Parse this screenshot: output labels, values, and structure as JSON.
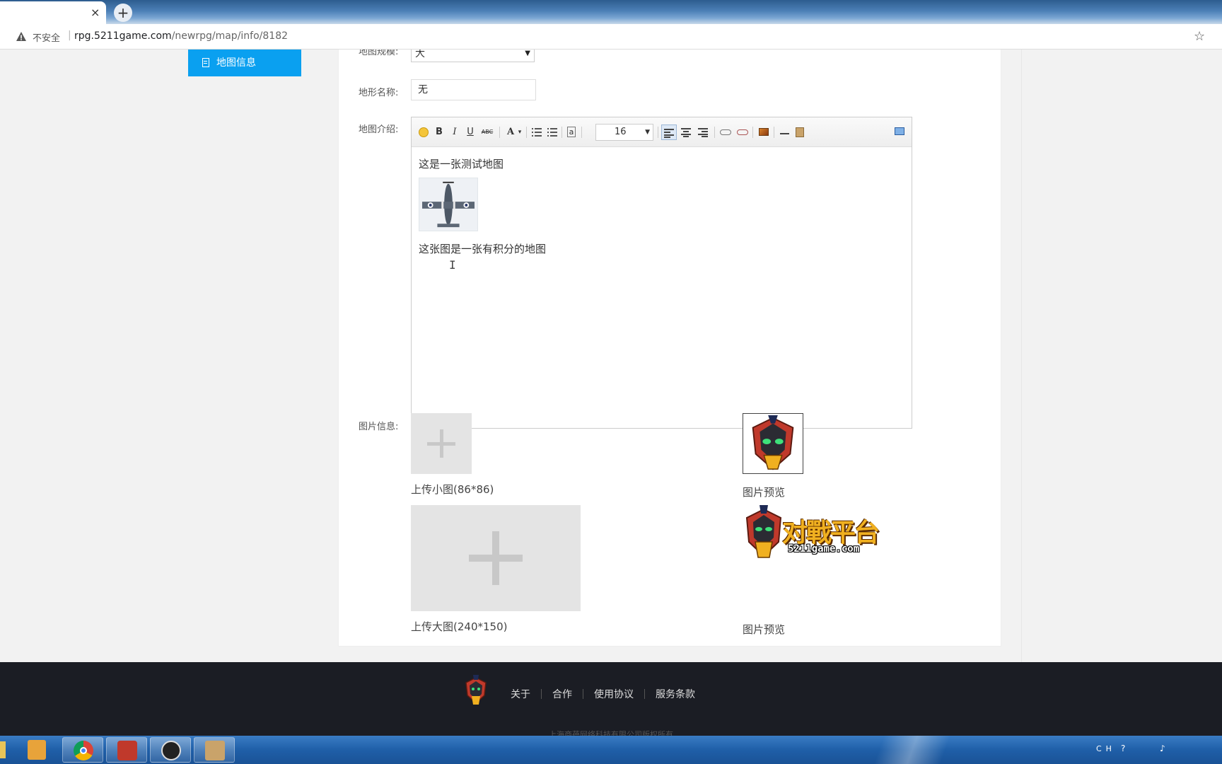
{
  "browser": {
    "tab_close": "×",
    "new_tab": "+",
    "security_label": "不安全",
    "url_host": "rpg.5211game.com",
    "url_path": "/newrpg/map/info/8182"
  },
  "sidebar": {
    "active_item": "地图信息"
  },
  "form": {
    "size_label": "地图规模:",
    "size_value": "大",
    "terrain_label": "地形名称:",
    "terrain_value": "无",
    "intro_label": "地图介绍:",
    "image_label": "图片信息:"
  },
  "editor": {
    "toolbar": {
      "bold": "B",
      "italic": "I",
      "underline": "U",
      "strike": "ABC",
      "font_color": "A",
      "caret": "▾",
      "text_box": "a",
      "font_size": "16"
    },
    "content": {
      "line1": "这是一张测试地图",
      "line2": "这张图是一张有积分的地图"
    }
  },
  "images": {
    "small_upload_caption": "上传小图(86*86)",
    "big_upload_caption": "上传大图(240*150)",
    "preview_caption": "图片预览",
    "logo_text": "对戰平台",
    "logo_domain": "5211game.com"
  },
  "footer": {
    "links": [
      "关于",
      "合作",
      "使用协议",
      "服务条款"
    ],
    "copyright": "上海商蓓网络科技有限公司版权所有"
  },
  "taskbar": {
    "tray_text": "CH"
  },
  "colors": {
    "accent": "#0aa0f0",
    "footer_bg": "#1b1d24",
    "logo_gold": "#f0b020"
  }
}
